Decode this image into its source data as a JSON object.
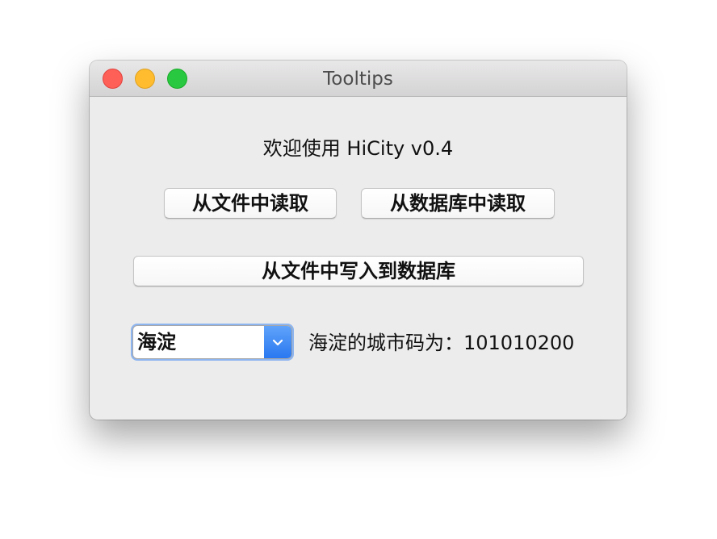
{
  "window": {
    "title": "Tooltips"
  },
  "main": {
    "welcome_text": "欢迎使用 HiCity v0.4",
    "read_file_button": "从文件中读取",
    "read_db_button": "从数据库中读取",
    "write_db_button": "从文件中写入到数据库",
    "district_select": {
      "selected_value": "海淀"
    },
    "city_code_label": "海淀的城市码为：101010200"
  },
  "colors": {
    "close": "#fe5f57",
    "minimize": "#febc2e",
    "zoom": "#28c840",
    "select_accent": "#2a78f1"
  },
  "icons": {
    "select_arrow": "chevron-down-icon"
  }
}
